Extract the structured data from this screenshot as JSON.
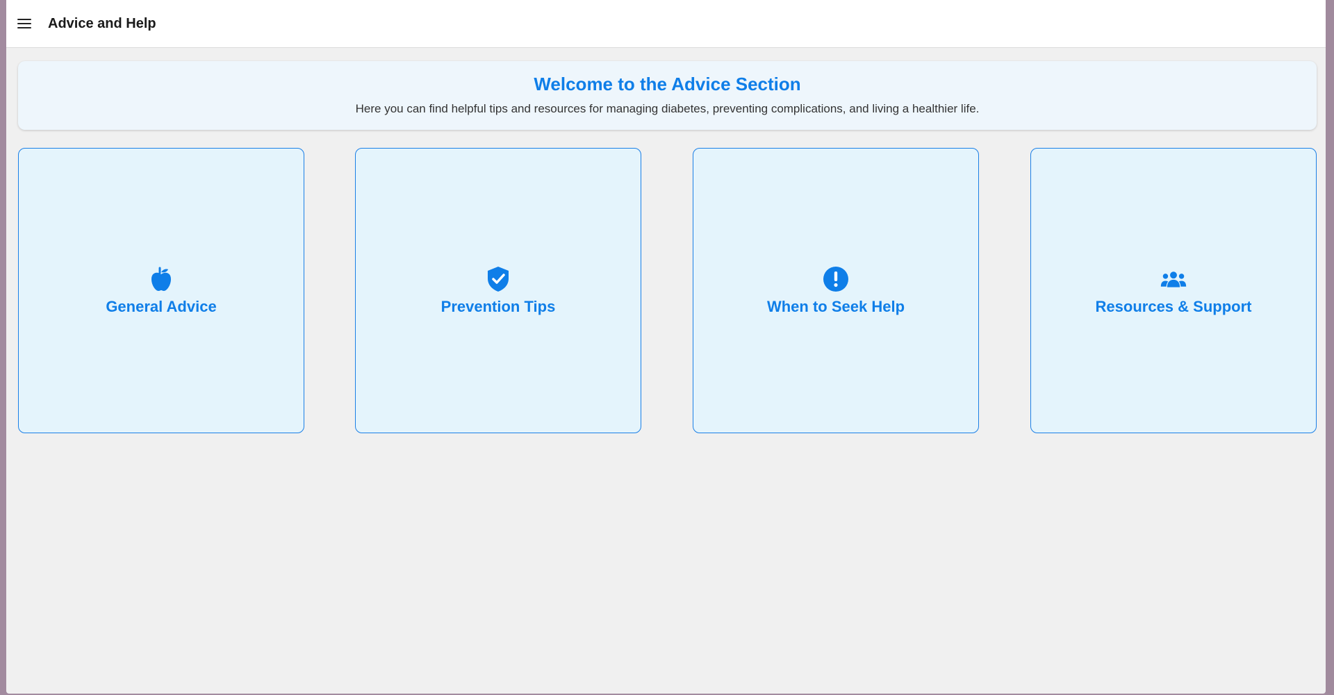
{
  "header": {
    "title": "Advice and Help",
    "menu_icon": "hamburger-menu-icon"
  },
  "welcome": {
    "title": "Welcome to the Advice Section",
    "subtitle": "Here you can find helpful tips and resources for managing diabetes, preventing complications, and living a healthier life."
  },
  "cards": [
    {
      "label": "General Advice",
      "icon": "apple-icon"
    },
    {
      "label": "Prevention Tips",
      "icon": "shield-check-icon"
    },
    {
      "label": "When to Seek Help",
      "icon": "exclamation-circle-icon"
    },
    {
      "label": "Resources & Support",
      "icon": "people-group-icon"
    }
  ],
  "colors": {
    "accent": "#0f7ee8",
    "card_bg": "#e4f4fc",
    "card_border": "#1a7fe6",
    "page_bg": "#f0f0f0"
  }
}
